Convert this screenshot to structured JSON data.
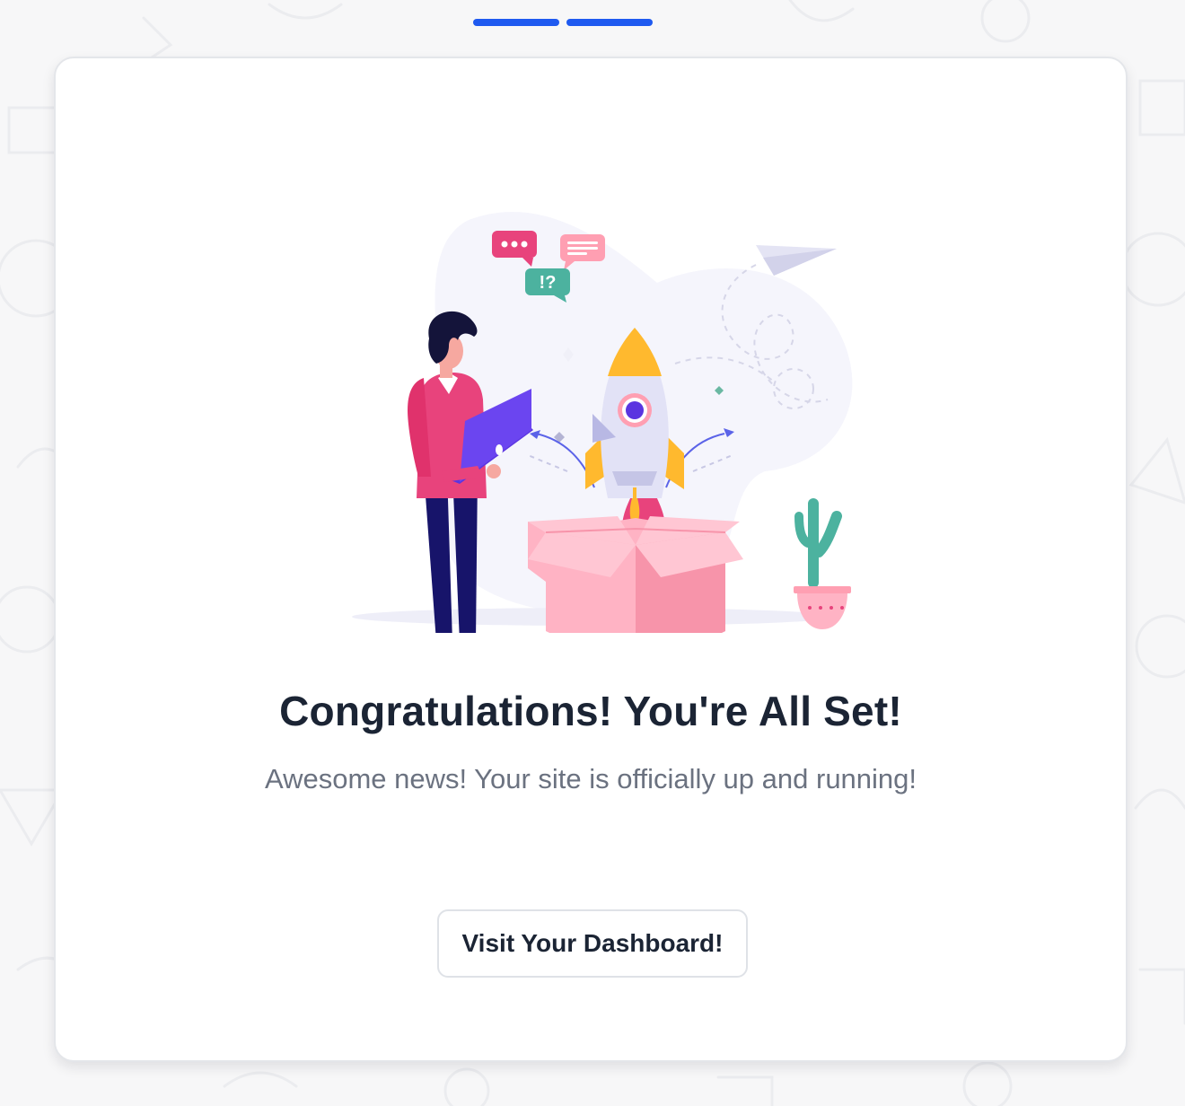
{
  "progress": {
    "steps_total": 2,
    "steps_completed": 2,
    "color": "#1f5af0"
  },
  "illustration": {
    "icons": [
      "chat-bubble-icon",
      "message-lines-icon",
      "question-bubble-icon",
      "paper-plane-icon",
      "rocket-icon",
      "gift-box-icon",
      "cactus-icon"
    ],
    "badge_text": "!?"
  },
  "main": {
    "title": "Congratulations! You're All Set!",
    "subtitle": "Awesome news! Your site is officially up and running!",
    "cta_label": "Visit Your Dashboard!"
  },
  "colors": {
    "accent": "#1f5af0",
    "title": "#1b2434",
    "subtitle": "#6b7280"
  }
}
